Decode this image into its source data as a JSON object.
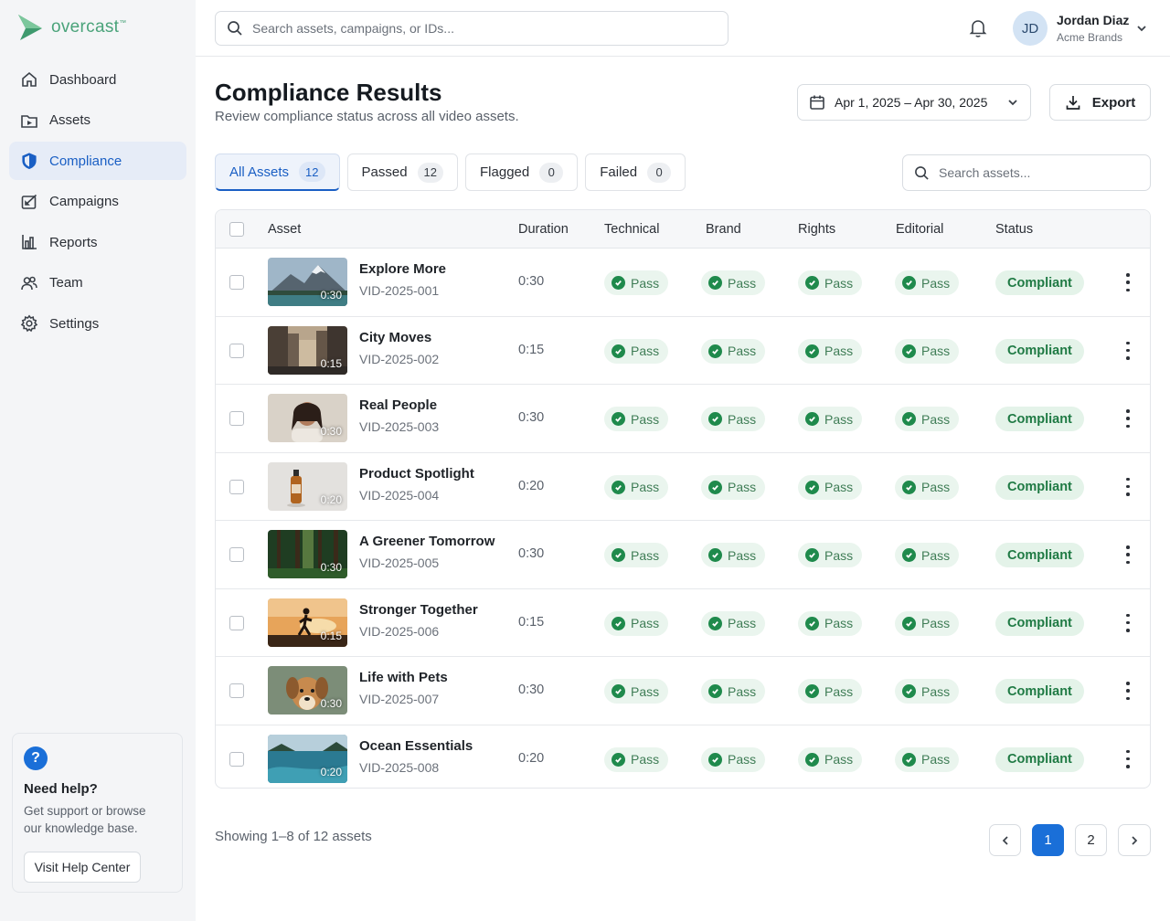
{
  "brand": {
    "name": "overcast",
    "tm": "™"
  },
  "nav": [
    {
      "label": "Dashboard",
      "icon": "home-icon"
    },
    {
      "label": "Assets",
      "icon": "assets-icon"
    },
    {
      "label": "Compliance",
      "icon": "shield-icon",
      "active": true
    },
    {
      "label": "Campaigns",
      "icon": "campaigns-icon"
    },
    {
      "label": "Reports",
      "icon": "reports-icon"
    },
    {
      "label": "Team",
      "icon": "team-icon"
    },
    {
      "label": "Settings",
      "icon": "gear-icon"
    }
  ],
  "help": {
    "title": "Need help?",
    "description": "Get support or browse our knowledge base.",
    "button": "Visit Help Center"
  },
  "topbar": {
    "search_placeholder": "Search assets, campaigns, or IDs...",
    "user": {
      "initials": "JD",
      "name": "Jordan Diaz",
      "org": "Acme Brands"
    }
  },
  "header": {
    "title": "Compliance Results",
    "subtitle": "Review compliance status across all video assets.",
    "date_range": "Apr 1, 2025 – Apr 30, 2025",
    "export_label": "Export"
  },
  "tabs": [
    {
      "label": "All Assets",
      "count": "12",
      "active": true
    },
    {
      "label": "Passed",
      "count": "12"
    },
    {
      "label": "Flagged",
      "count": "0"
    },
    {
      "label": "Failed",
      "count": "0"
    }
  ],
  "assets_search_placeholder": "Search assets...",
  "table": {
    "columns": [
      "Asset",
      "Duration",
      "Technical",
      "Brand",
      "Rights",
      "Editorial",
      "Status"
    ],
    "rows": [
      {
        "name": "Explore More",
        "id": "VID-2025-001",
        "duration": "0:30",
        "technical": "Pass",
        "brand": "Pass",
        "rights": "Pass",
        "editorial": "Pass",
        "status": "Compliant",
        "thumb": "mountain"
      },
      {
        "name": "City Moves",
        "id": "VID-2025-002",
        "duration": "0:15",
        "technical": "Pass",
        "brand": "Pass",
        "rights": "Pass",
        "editorial": "Pass",
        "status": "Compliant",
        "thumb": "city"
      },
      {
        "name": "Real People",
        "id": "VID-2025-003",
        "duration": "0:30",
        "technical": "Pass",
        "brand": "Pass",
        "rights": "Pass",
        "editorial": "Pass",
        "status": "Compliant",
        "thumb": "person"
      },
      {
        "name": "Product Spotlight",
        "id": "VID-2025-004",
        "duration": "0:20",
        "technical": "Pass",
        "brand": "Pass",
        "rights": "Pass",
        "editorial": "Pass",
        "status": "Compliant",
        "thumb": "bottle"
      },
      {
        "name": "A Greener Tomorrow",
        "id": "VID-2025-005",
        "duration": "0:30",
        "technical": "Pass",
        "brand": "Pass",
        "rights": "Pass",
        "editorial": "Pass",
        "status": "Compliant",
        "thumb": "forest"
      },
      {
        "name": "Stronger Together",
        "id": "VID-2025-006",
        "duration": "0:15",
        "technical": "Pass",
        "brand": "Pass",
        "rights": "Pass",
        "editorial": "Pass",
        "status": "Compliant",
        "thumb": "runner"
      },
      {
        "name": "Life with Pets",
        "id": "VID-2025-007",
        "duration": "0:30",
        "technical": "Pass",
        "brand": "Pass",
        "rights": "Pass",
        "editorial": "Pass",
        "status": "Compliant",
        "thumb": "dog"
      },
      {
        "name": "Ocean Essentials",
        "id": "VID-2025-008",
        "duration": "0:20",
        "technical": "Pass",
        "brand": "Pass",
        "rights": "Pass",
        "editorial": "Pass",
        "status": "Compliant",
        "thumb": "ocean"
      }
    ]
  },
  "pagination": {
    "summary": "Showing 1–8 of 12 assets",
    "pages": [
      "1",
      "2"
    ],
    "current": "1"
  },
  "colors": {
    "accent": "#1a6fd8",
    "pass_green": "#1f8a4c",
    "compliant_bg": "#e4f3e9"
  }
}
